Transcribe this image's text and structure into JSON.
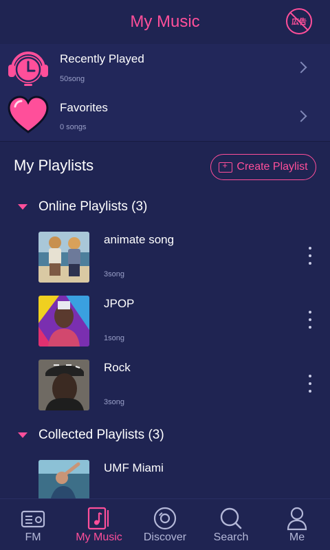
{
  "header": {
    "title": "My Music",
    "noad_label": "広告"
  },
  "quick": [
    {
      "title": "Recently Played",
      "sub": "50song",
      "icon": "headphones-clock-icon"
    },
    {
      "title": "Favorites",
      "sub": "0 songs",
      "icon": "heart-icon"
    }
  ],
  "playlists": {
    "title": "My Playlists",
    "create_label": "Create Playlist"
  },
  "online": {
    "title": "Online Playlists (3)",
    "items": [
      {
        "name": "animate song",
        "count": "3song"
      },
      {
        "name": "JPOP",
        "count": "1song"
      },
      {
        "name": "Rock",
        "count": "3song"
      }
    ]
  },
  "collected": {
    "title": "Collected Playlists (3)",
    "items": [
      {
        "name": "UMF Miami"
      }
    ]
  },
  "tabs": [
    {
      "label": "FM",
      "icon": "radio-icon"
    },
    {
      "label": "My Music",
      "icon": "music-note-icon"
    },
    {
      "label": "Discover",
      "icon": "disc-icon"
    },
    {
      "label": "Search",
      "icon": "search-icon"
    },
    {
      "label": "Me",
      "icon": "person-icon"
    }
  ],
  "colors": {
    "accent": "#ff4f9a",
    "background": "#1f2452",
    "card": "#22275a"
  }
}
